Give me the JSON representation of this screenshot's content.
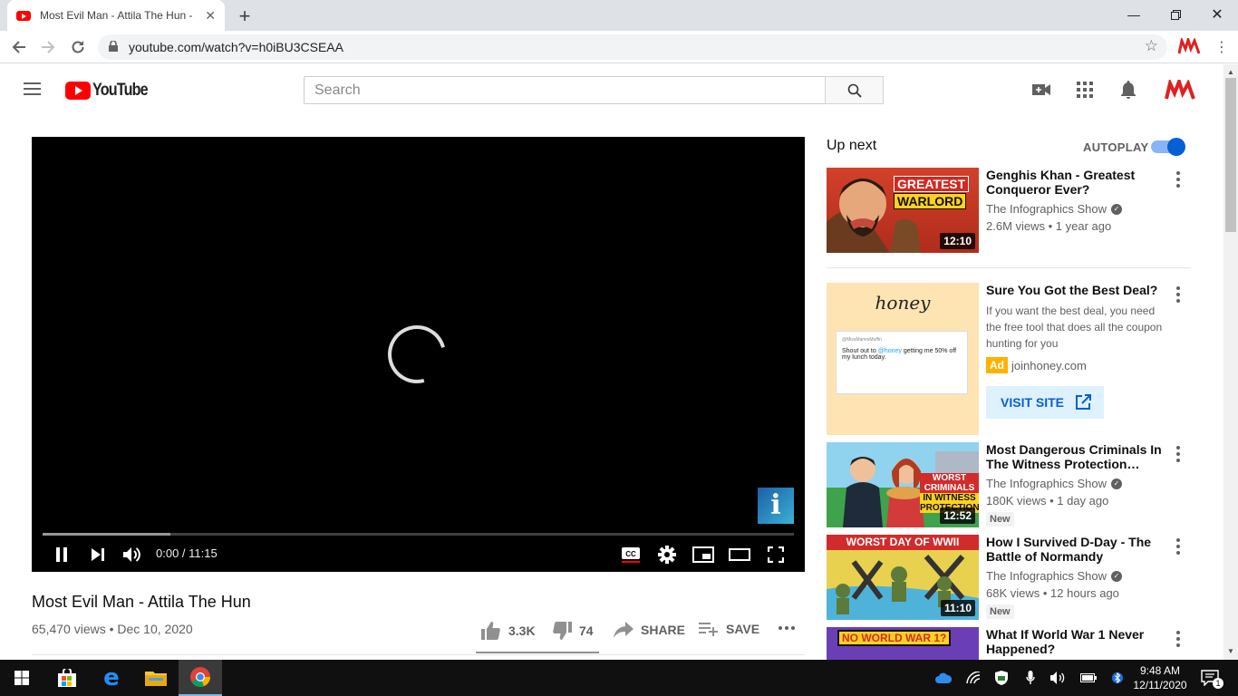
{
  "browser": {
    "tab_title": "Most Evil Man - Attila The Hun -",
    "url": "youtube.com/watch?v=h0iBU3CSEAA"
  },
  "youtube": {
    "logo_text": "YouTube",
    "search_placeholder": "Search"
  },
  "player": {
    "time_display": "0:00 / 11:15",
    "buffered_fraction": 0.17,
    "watermark": "i"
  },
  "video": {
    "title": "Most Evil Man - Attila The Hun",
    "meta": "65,470 views • Dec 10, 2020",
    "likes": "3.3K",
    "dislikes": "74",
    "share_label": "SHARE",
    "save_label": "SAVE",
    "like_fraction": 0.98
  },
  "sidebar": {
    "up_next_label": "Up next",
    "autoplay_label": "AUTOPLAY",
    "autoplay_on": true,
    "items": [
      {
        "title": "Genghis Khan - Greatest Conqueror Ever?",
        "channel": "The Infographics Show",
        "views": "2.6M views • 1 year ago",
        "duration": "12:10",
        "thumb_text_1": "GREATEST",
        "thumb_text_2": "WARLORD"
      },
      {
        "title": "Most Dangerous Criminals In The Witness Protection…",
        "channel": "The Infographics Show",
        "views": "180K views • 1 day ago",
        "duration": "12:52",
        "badge": "New",
        "thumb_text_1": "WORST",
        "thumb_text_2": "CRIMINALS",
        "thumb_text_3": "IN WITNESS",
        "thumb_text_4": "PROTECTION"
      },
      {
        "title": "How I Survived D-Day - The Battle of Normandy",
        "channel": "The Infographics Show",
        "views": "68K views • 12 hours ago",
        "duration": "11:10",
        "badge": "New",
        "thumb_text_1": "WORST DAY OF WWII"
      },
      {
        "title": "What If World War 1 Never Happened?",
        "thumb_text_1": "NO WORLD WAR 1?"
      }
    ],
    "ad": {
      "title": "Sure You Got the Best Deal?",
      "description": "If you want the best deal, you need the free tool that does all the coupon hunting for you",
      "badge": "Ad",
      "domain": "joinhoney.com",
      "button": "VISIT SITE",
      "thumb_brand": "honey",
      "tweet_handle": "@MissMariesMuffin",
      "tweet_text_1": "Shout out to ",
      "tweet_mention": "@honey",
      "tweet_text_2": " getting me 50% off my lunch today."
    }
  },
  "taskbar": {
    "time": "9:48 AM",
    "date": "12/11/2020",
    "notification_count": "1"
  }
}
